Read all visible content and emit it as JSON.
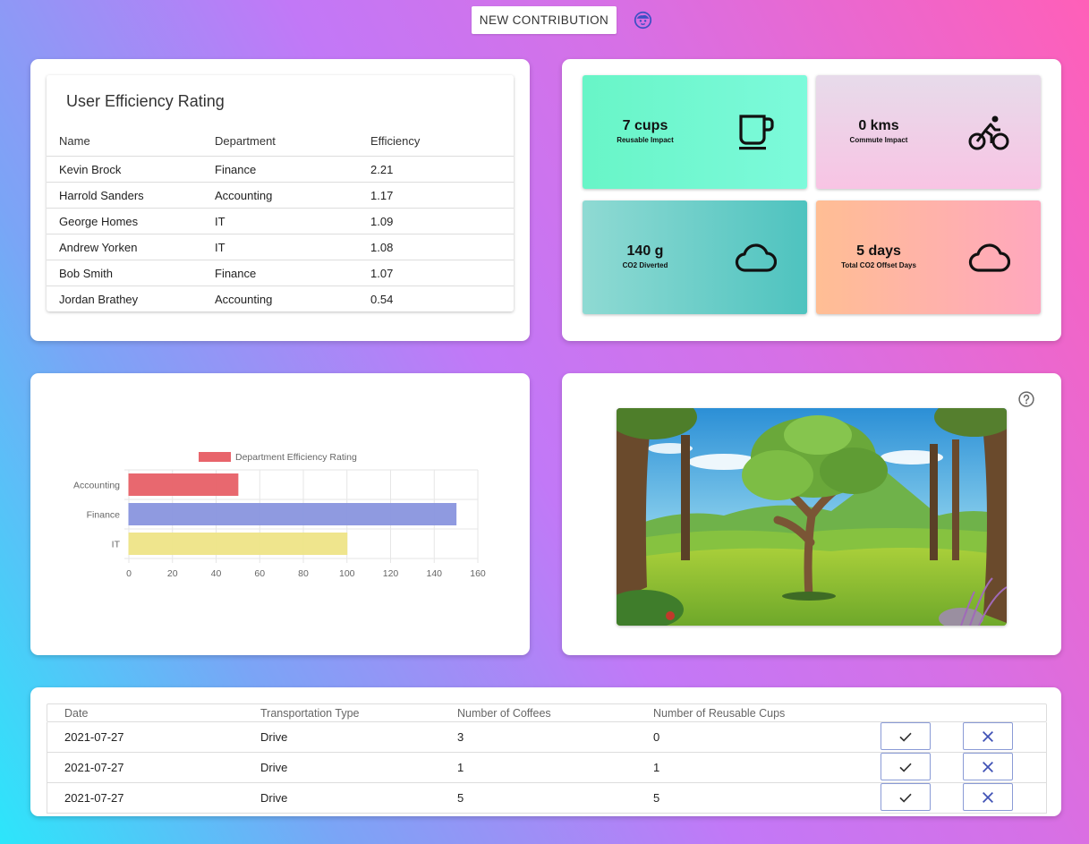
{
  "header": {
    "new_contribution_label": "NEW CONTRIBUTION",
    "avatar_icon": "baby-face-icon"
  },
  "efficiency": {
    "title": "User Efficiency Rating",
    "columns": [
      "Name",
      "Department",
      "Efficiency"
    ],
    "rows": [
      [
        "Kevin Brock",
        "Finance",
        "2.21"
      ],
      [
        "Harrold Sanders",
        "Accounting",
        "1.17"
      ],
      [
        "George Homes",
        "IT",
        "1.09"
      ],
      [
        "Andrew Yorken",
        "IT",
        "1.08"
      ],
      [
        "Bob Smith",
        "Finance",
        "1.07"
      ],
      [
        "Jordan Brathey",
        "Accounting",
        "0.54"
      ]
    ]
  },
  "stats": [
    {
      "value": "7 cups",
      "label": "Reusable Impact",
      "icon": "coffee-cup-icon",
      "gradient": [
        "#68f5c7",
        "#7dfadb"
      ]
    },
    {
      "value": "0 kms",
      "label": "Commute Impact",
      "icon": "bicycle-icon",
      "gradient": [
        "#e7d9ec",
        "#f8c4e4"
      ]
    },
    {
      "value": "140 g",
      "label": "CO2 Diverted",
      "icon": "cloud-icon",
      "gradient": [
        "#8ad8d2",
        "#52c4c0"
      ]
    },
    {
      "value": "5 days",
      "label": "Total CO2 Offset Days",
      "icon": "cloud-icon",
      "gradient": [
        "#ffbd95",
        "#ffa8bd"
      ]
    }
  ],
  "chart_data": {
    "type": "bar",
    "orientation": "horizontal",
    "categories": [
      "Accounting",
      "Finance",
      "IT"
    ],
    "series": [
      {
        "name": "Department Efficiency Rating",
        "values": [
          50,
          150,
          100
        ],
        "colors": [
          "#e8646b",
          "#8c97e0",
          "#efe58a"
        ]
      }
    ],
    "xlim": [
      0,
      160
    ],
    "xticks": [
      "0",
      "20",
      "40",
      "60",
      "80",
      "100",
      "120",
      "140",
      "160"
    ],
    "grid": true,
    "legend": "top"
  },
  "tree_panel": {
    "help_icon": "help-circle-icon",
    "image": "forest-tree-illustration"
  },
  "contributions": {
    "columns": [
      "Date",
      "Transportation Type",
      "Number of Coffees",
      "Number of Reusable Cups"
    ],
    "rows": [
      [
        "2021-07-27",
        "Drive",
        "3",
        "0"
      ],
      [
        "2021-07-27",
        "Drive",
        "1",
        "1"
      ],
      [
        "2021-07-27",
        "Drive",
        "5",
        "5"
      ]
    ],
    "approve_icon": "check-icon",
    "reject_icon": "close-icon"
  }
}
